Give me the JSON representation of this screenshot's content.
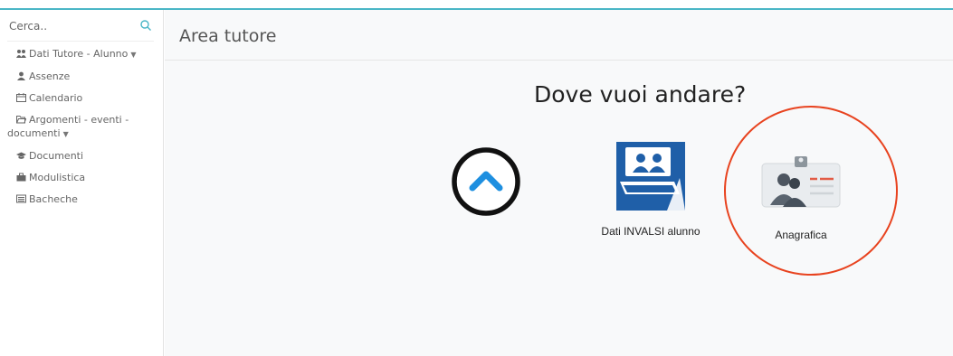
{
  "search": {
    "placeholder": "Cerca.."
  },
  "sidebar": {
    "items": [
      {
        "label": "Dati Tutore - Alunno",
        "caret": "▼",
        "icon": "users-icon"
      },
      {
        "label": "Assenze",
        "icon": "user-icon"
      },
      {
        "label": "Calendario",
        "icon": "calendar-icon"
      },
      {
        "label_line1": "Argomenti - eventi -",
        "label_line2": "documenti",
        "caret": "▼",
        "icon": "folder-open-icon"
      },
      {
        "label": "Documenti",
        "icon": "graduation-cap-icon"
      },
      {
        "label": "Modulistica",
        "icon": "briefcase-icon"
      },
      {
        "label": "Bacheche",
        "icon": "list-alt-icon"
      }
    ]
  },
  "header": {
    "title": "Area tutore"
  },
  "main": {
    "question": "Dove vuoi andare?",
    "tiles": [
      {
        "label": "",
        "icon": "chevron-up-circle-icon"
      },
      {
        "label": "Dati INVALSI alunno",
        "icon": "invalsi-classroom-icon",
        "color": "#1f5fa8"
      },
      {
        "label": "Anagrafica",
        "icon": "id-card-icon"
      }
    ]
  },
  "colors": {
    "accent": "#4ab6c6",
    "highlight": "#e8431f",
    "invalsi_blue": "#1f5fa8"
  }
}
